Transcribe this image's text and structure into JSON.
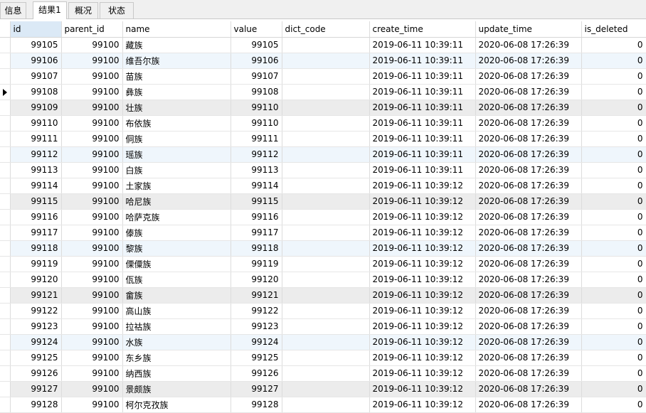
{
  "tabs": [
    "信息",
    "结果1",
    "概况",
    "状态"
  ],
  "columns": [
    "id",
    "parent_id",
    "name",
    "value",
    "dict_code",
    "create_time",
    "update_time",
    "is_deleted"
  ],
  "rows": [
    {
      "id": "99105",
      "parent_id": "99100",
      "name": "藏族",
      "value": "99105",
      "dict_code": "",
      "create_time": "2019-06-11 10:39:11",
      "update_time": "2020-06-08 17:26:39",
      "is_deleted": "0"
    },
    {
      "id": "99106",
      "parent_id": "99100",
      "name": "维吾尔族",
      "value": "99106",
      "dict_code": "",
      "create_time": "2019-06-11 10:39:11",
      "update_time": "2020-06-08 17:26:39",
      "is_deleted": "0"
    },
    {
      "id": "99107",
      "parent_id": "99100",
      "name": "苗族",
      "value": "99107",
      "dict_code": "",
      "create_time": "2019-06-11 10:39:11",
      "update_time": "2020-06-08 17:26:39",
      "is_deleted": "0"
    },
    {
      "id": "99108",
      "parent_id": "99100",
      "name": "彝族",
      "value": "99108",
      "dict_code": "",
      "create_time": "2019-06-11 10:39:11",
      "update_time": "2020-06-08 17:26:39",
      "is_deleted": "0"
    },
    {
      "id": "99109",
      "parent_id": "99100",
      "name": "壮族",
      "value": "99110",
      "dict_code": "",
      "create_time": "2019-06-11 10:39:11",
      "update_time": "2020-06-08 17:26:39",
      "is_deleted": "0"
    },
    {
      "id": "99110",
      "parent_id": "99100",
      "name": "布依族",
      "value": "99110",
      "dict_code": "",
      "create_time": "2019-06-11 10:39:11",
      "update_time": "2020-06-08 17:26:39",
      "is_deleted": "0"
    },
    {
      "id": "99111",
      "parent_id": "99100",
      "name": "侗族",
      "value": "99111",
      "dict_code": "",
      "create_time": "2019-06-11 10:39:11",
      "update_time": "2020-06-08 17:26:39",
      "is_deleted": "0"
    },
    {
      "id": "99112",
      "parent_id": "99100",
      "name": "瑶族",
      "value": "99112",
      "dict_code": "",
      "create_time": "2019-06-11 10:39:11",
      "update_time": "2020-06-08 17:26:39",
      "is_deleted": "0"
    },
    {
      "id": "99113",
      "parent_id": "99100",
      "name": "白族",
      "value": "99113",
      "dict_code": "",
      "create_time": "2019-06-11 10:39:11",
      "update_time": "2020-06-08 17:26:39",
      "is_deleted": "0"
    },
    {
      "id": "99114",
      "parent_id": "99100",
      "name": "土家族",
      "value": "99114",
      "dict_code": "",
      "create_time": "2019-06-11 10:39:12",
      "update_time": "2020-06-08 17:26:39",
      "is_deleted": "0"
    },
    {
      "id": "99115",
      "parent_id": "99100",
      "name": "哈尼族",
      "value": "99115",
      "dict_code": "",
      "create_time": "2019-06-11 10:39:12",
      "update_time": "2020-06-08 17:26:39",
      "is_deleted": "0"
    },
    {
      "id": "99116",
      "parent_id": "99100",
      "name": "哈萨克族",
      "value": "99116",
      "dict_code": "",
      "create_time": "2019-06-11 10:39:12",
      "update_time": "2020-06-08 17:26:39",
      "is_deleted": "0"
    },
    {
      "id": "99117",
      "parent_id": "99100",
      "name": "傣族",
      "value": "99117",
      "dict_code": "",
      "create_time": "2019-06-11 10:39:12",
      "update_time": "2020-06-08 17:26:39",
      "is_deleted": "0"
    },
    {
      "id": "99118",
      "parent_id": "99100",
      "name": "黎族",
      "value": "99118",
      "dict_code": "",
      "create_time": "2019-06-11 10:39:12",
      "update_time": "2020-06-08 17:26:39",
      "is_deleted": "0"
    },
    {
      "id": "99119",
      "parent_id": "99100",
      "name": "傈僳族",
      "value": "99119",
      "dict_code": "",
      "create_time": "2019-06-11 10:39:12",
      "update_time": "2020-06-08 17:26:39",
      "is_deleted": "0"
    },
    {
      "id": "99120",
      "parent_id": "99100",
      "name": "佤族",
      "value": "99120",
      "dict_code": "",
      "create_time": "2019-06-11 10:39:12",
      "update_time": "2020-06-08 17:26:39",
      "is_deleted": "0"
    },
    {
      "id": "99121",
      "parent_id": "99100",
      "name": "畲族",
      "value": "99121",
      "dict_code": "",
      "create_time": "2019-06-11 10:39:12",
      "update_time": "2020-06-08 17:26:39",
      "is_deleted": "0"
    },
    {
      "id": "99122",
      "parent_id": "99100",
      "name": "高山族",
      "value": "99122",
      "dict_code": "",
      "create_time": "2019-06-11 10:39:12",
      "update_time": "2020-06-08 17:26:39",
      "is_deleted": "0"
    },
    {
      "id": "99123",
      "parent_id": "99100",
      "name": "拉祜族",
      "value": "99123",
      "dict_code": "",
      "create_time": "2019-06-11 10:39:12",
      "update_time": "2020-06-08 17:26:39",
      "is_deleted": "0"
    },
    {
      "id": "99124",
      "parent_id": "99100",
      "name": "水族",
      "value": "99124",
      "dict_code": "",
      "create_time": "2019-06-11 10:39:12",
      "update_time": "2020-06-08 17:26:39",
      "is_deleted": "0"
    },
    {
      "id": "99125",
      "parent_id": "99100",
      "name": "东乡族",
      "value": "99125",
      "dict_code": "",
      "create_time": "2019-06-11 10:39:12",
      "update_time": "2020-06-08 17:26:39",
      "is_deleted": "0"
    },
    {
      "id": "99126",
      "parent_id": "99100",
      "name": "纳西族",
      "value": "99126",
      "dict_code": "",
      "create_time": "2019-06-11 10:39:12",
      "update_time": "2020-06-08 17:26:39",
      "is_deleted": "0"
    },
    {
      "id": "99127",
      "parent_id": "99100",
      "name": "景颇族",
      "value": "99127",
      "dict_code": "",
      "create_time": "2019-06-11 10:39:12",
      "update_time": "2020-06-08 17:26:39",
      "is_deleted": "0"
    },
    {
      "id": "99128",
      "parent_id": "99100",
      "name": "柯尔克孜族",
      "value": "99128",
      "dict_code": "",
      "create_time": "2019-06-11 10:39:12",
      "update_time": "2020-06-08 17:26:39",
      "is_deleted": "0"
    }
  ],
  "colors": {
    "selected_header": "#dbe9f6",
    "alt_row": "#eff6fc",
    "grey_row": "#ececec"
  },
  "current_row_indicator": "arrow-right-icon"
}
